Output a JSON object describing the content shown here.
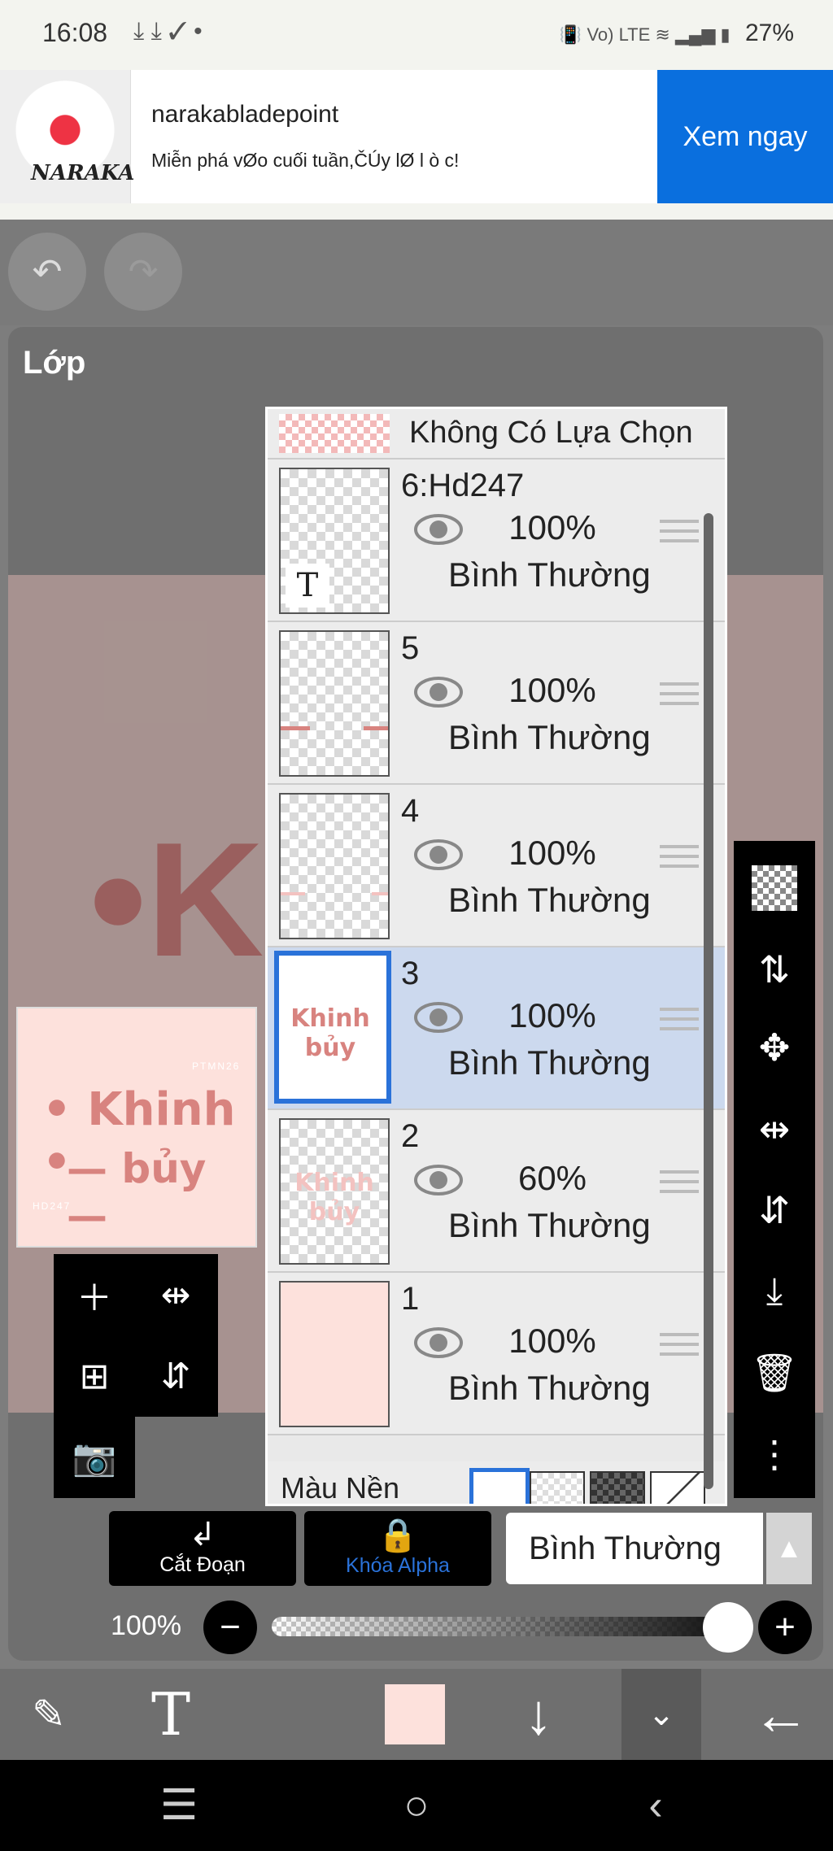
{
  "status_bar": {
    "time": "16:08",
    "downloads": "⤓ ⤓ ✓ •",
    "battery": "27%",
    "indicators": "Vo) LTE"
  },
  "ad": {
    "name": "narakabladepoint",
    "description": "Miễn phá vØo cuối tuần,ČÚy lØ l ò c!",
    "cta": "Xem ngay",
    "logo_text": "NARAKA"
  },
  "panel": {
    "title": "Lớp"
  },
  "preview": {
    "line1": "• Khinh •",
    "line2": "— bủy —",
    "small1": "PTMN26",
    "small2": "HD247"
  },
  "layers": {
    "no_selection": "Không Có Lựa Chọn",
    "items": [
      {
        "name": "6:Hd247",
        "opacity": "100%",
        "mode": "Bình Thường"
      },
      {
        "name": "5",
        "opacity": "100%",
        "mode": "Bình Thường"
      },
      {
        "name": "4",
        "opacity": "100%",
        "mode": "Bình Thường"
      },
      {
        "name": "3",
        "opacity": "100%",
        "mode": "Bình Thường",
        "thumb_text": "Khinh bủy"
      },
      {
        "name": "2",
        "opacity": "60%",
        "mode": "Bình Thường",
        "thumb_text": "Khinh bủy"
      },
      {
        "name": "1",
        "opacity": "100%",
        "mode": "Bình Thường"
      }
    ],
    "background_label": "Màu Nền"
  },
  "blend_bar": {
    "clip_label": "Cắt Đoạn",
    "alpha_label": "Khóa Alpha",
    "mode": "Bình Thường"
  },
  "opacity": {
    "label": "100%",
    "value": 1.0
  },
  "colors": {
    "accent": "#2a72d9",
    "ad_button": "#0a6fde",
    "current_color": "#fde1dc"
  }
}
